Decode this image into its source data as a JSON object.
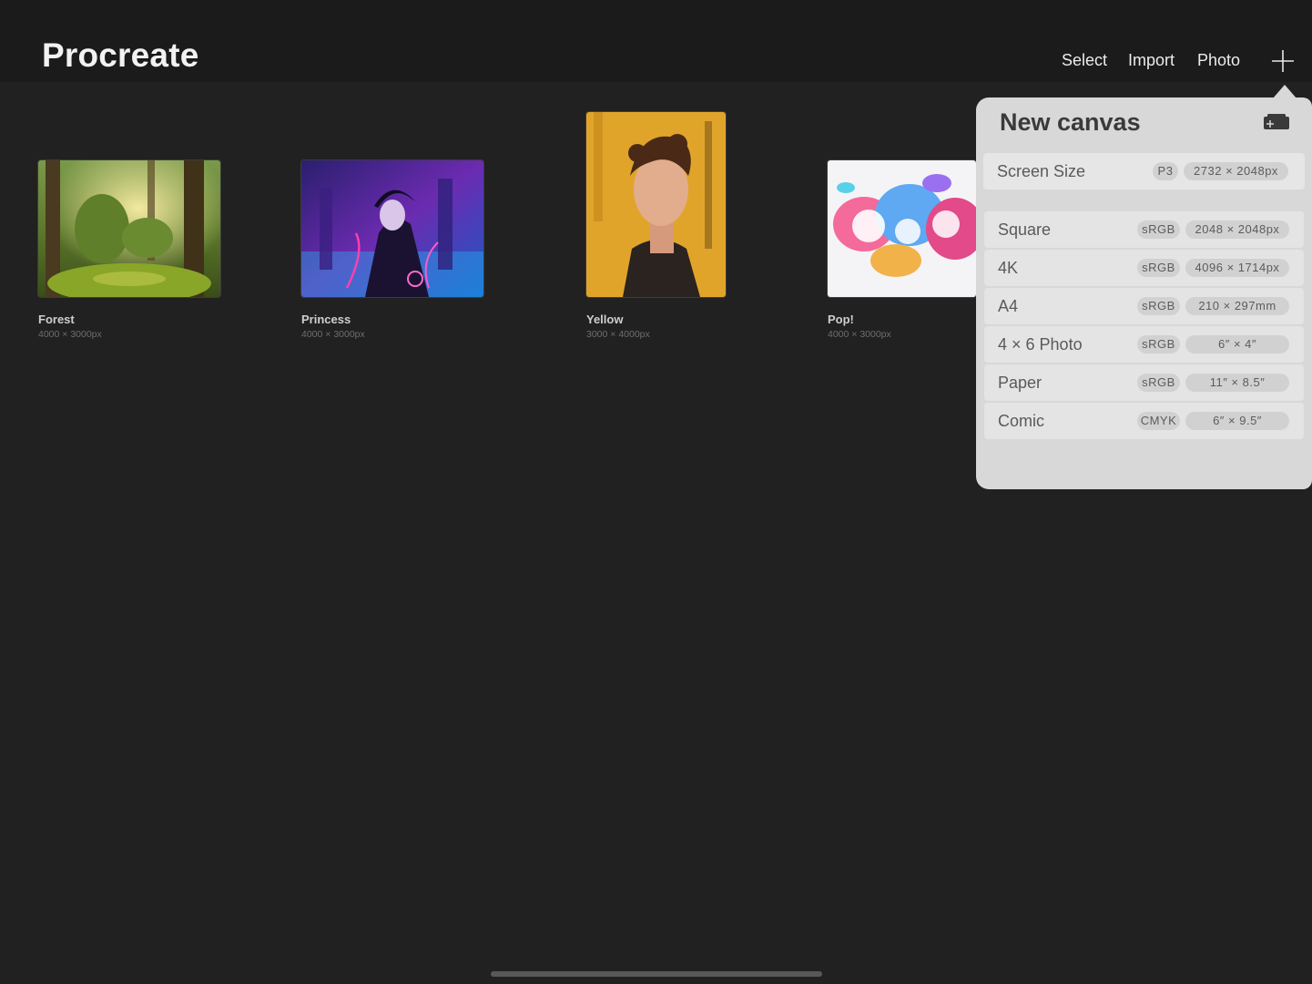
{
  "app": {
    "title": "Procreate"
  },
  "toolbar": {
    "select_label": "Select",
    "import_label": "Import",
    "photo_label": "Photo",
    "new_icon": "plus-icon"
  },
  "gallery": {
    "artworks": [
      {
        "title": "Forest",
        "size": "4000 × 3000px"
      },
      {
        "title": "Princess",
        "size": "4000 × 3000px"
      },
      {
        "title": "Yellow",
        "size": "3000 × 4000px"
      },
      {
        "title": "Pop!",
        "size": "4000 × 3000px"
      }
    ]
  },
  "new_canvas": {
    "title": "New canvas",
    "custom_icon": "new-custom-canvas-icon",
    "presets": [
      {
        "label": "Screen Size",
        "profile": "P3",
        "dims": "2732 × 2048px"
      },
      {
        "label": "Square",
        "profile": "sRGB",
        "dims": "2048 × 2048px"
      },
      {
        "label": "4K",
        "profile": "sRGB",
        "dims": "4096 × 1714px"
      },
      {
        "label": "A4",
        "profile": "sRGB",
        "dims": "210 × 297mm"
      },
      {
        "label": "4 × 6 Photo",
        "profile": "sRGB",
        "dims": "6″ × 4″"
      },
      {
        "label": "Paper",
        "profile": "sRGB",
        "dims": "11″ × 8.5″"
      },
      {
        "label": "Comic",
        "profile": "CMYK",
        "dims": "6″ × 9.5″"
      }
    ]
  },
  "colors": {
    "background": "#212121",
    "topbar": "#1b1b1b",
    "popover": "#d8d8d8"
  }
}
